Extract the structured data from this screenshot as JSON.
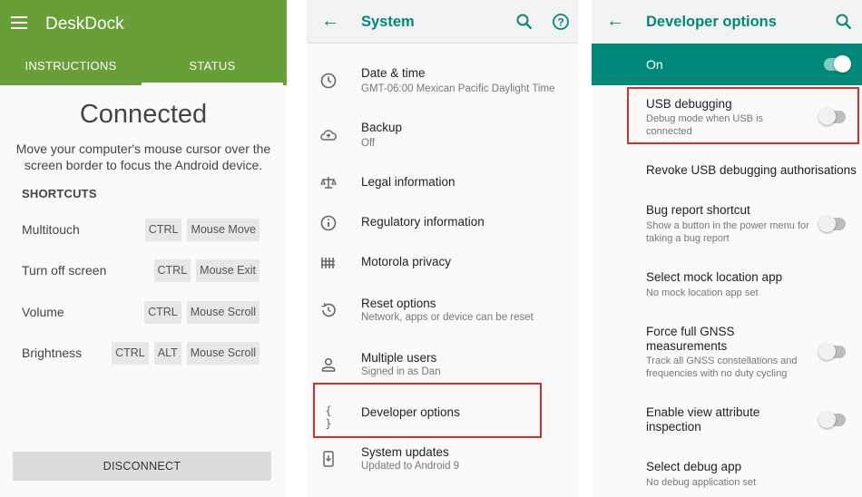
{
  "deskdock": {
    "app_title": "DeskDock",
    "tabs": [
      "INSTRUCTIONS",
      "STATUS"
    ],
    "active_tab": "STATUS",
    "heading": "Connected",
    "description": "Move your computer's mouse cursor over the screen border to focus the Android device.",
    "section_title": "SHORTCUTS",
    "shortcuts": [
      {
        "label": "Multitouch",
        "keys": [
          "CTRL",
          "Mouse Move"
        ]
      },
      {
        "label": "Turn off screen",
        "keys": [
          "CTRL",
          "Mouse Exit"
        ]
      },
      {
        "label": "Volume",
        "keys": [
          "CTRL",
          "Mouse Scroll"
        ]
      },
      {
        "label": "Brightness",
        "keys": [
          "CTRL",
          "ALT",
          "Mouse Scroll"
        ]
      }
    ],
    "disconnect_label": "DISCONNECT",
    "accent_color": "#689f38"
  },
  "system": {
    "title": "System",
    "icons": {
      "back": "arrow-left-icon",
      "search": "search-icon",
      "help": "help-circle-icon"
    },
    "items": [
      {
        "title": "Date & time",
        "subtitle": "GMT-06:00 Mexican Pacific Daylight Time",
        "icon": "clock-icon"
      },
      {
        "title": "Backup",
        "subtitle": "Off",
        "icon": "cloud-upload-icon"
      },
      {
        "title": "Legal information",
        "subtitle": "",
        "icon": "scales-icon"
      },
      {
        "title": "Regulatory information",
        "subtitle": "",
        "icon": "info-icon"
      },
      {
        "title": "Motorola privacy",
        "subtitle": "",
        "icon": "privacy-icon"
      },
      {
        "title": "Reset options",
        "subtitle": "Network, apps or device can be reset",
        "icon": "history-icon"
      },
      {
        "title": "Multiple users",
        "subtitle": "Signed in as Dan",
        "icon": "person-icon"
      },
      {
        "title": "Developer options",
        "subtitle": "",
        "icon": "braces-icon"
      },
      {
        "title": "System updates",
        "subtitle": "Updated to Android 9",
        "icon": "system-update-icon"
      }
    ],
    "braces_glyph": "{ }"
  },
  "developer": {
    "title": "Developer options",
    "master_label": "On",
    "master_on": true,
    "items": [
      {
        "title": "USB debugging",
        "subtitle": "Debug mode when USB is connected",
        "switch": false
      },
      {
        "title": "Revoke USB debugging authorisations",
        "subtitle": ""
      },
      {
        "title": "Bug report shortcut",
        "subtitle": "Show a button in the power menu for taking a bug report",
        "switch": false
      },
      {
        "title": "Select mock location app",
        "subtitle": "No mock location app set"
      },
      {
        "title": "Force full GNSS measurements",
        "subtitle": "Track all GNSS constellations and frequencies with no duty cycling",
        "switch": false
      },
      {
        "title": "Enable view attribute inspection",
        "subtitle": "",
        "switch": false
      },
      {
        "title": "Select debug app",
        "subtitle": "No debug application set"
      }
    ],
    "accent_color": "#00897b",
    "highlight_color": "#d32f2f"
  }
}
